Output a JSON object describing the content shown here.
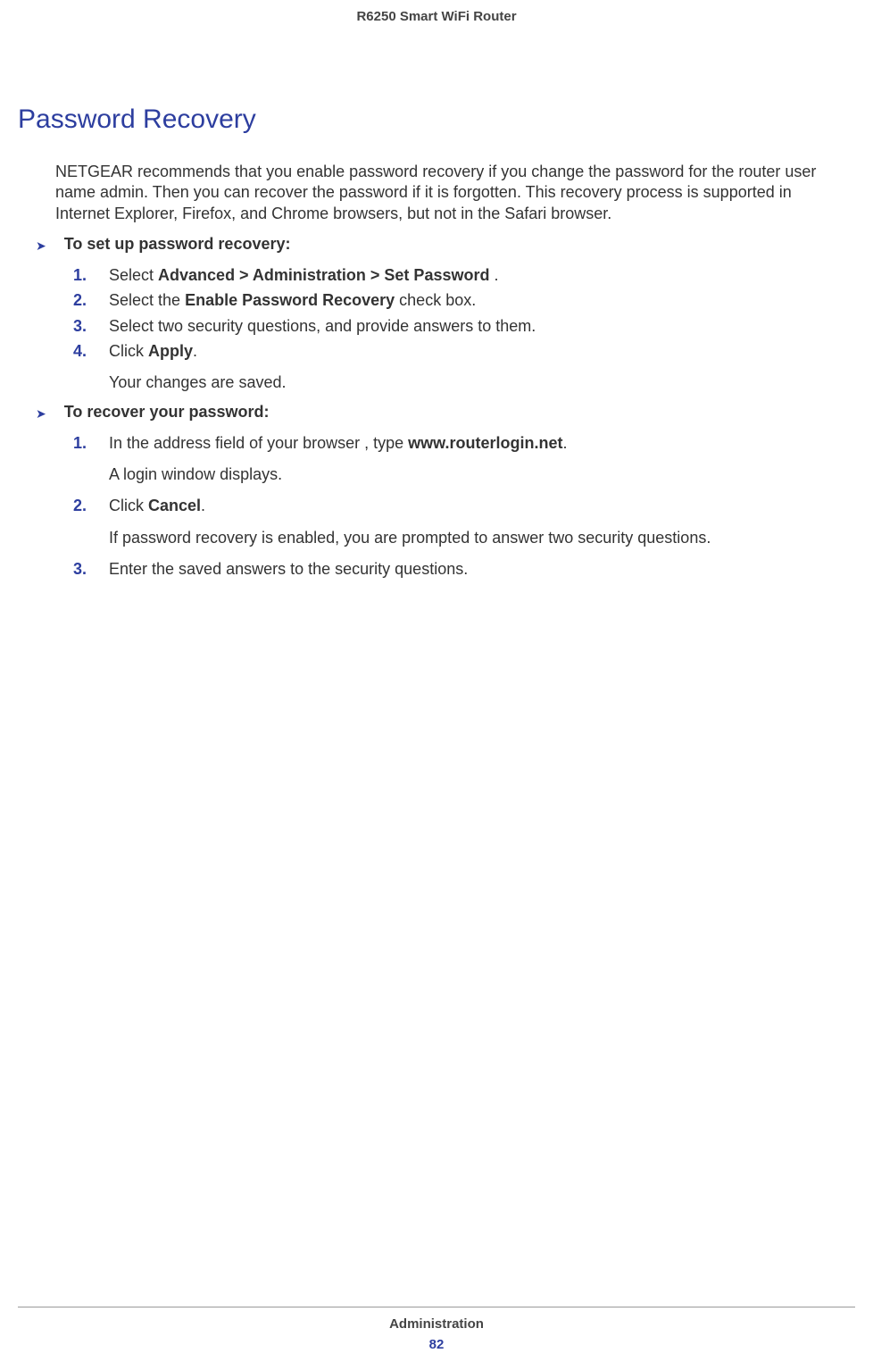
{
  "header": {
    "title": "R6250 Smart WiFi Router"
  },
  "section": {
    "title": "Password Recovery",
    "intro": "NETGEAR recommends that you enable password recovery if you change the password for the router user name admin. Then you can recover the password if it is forgotten. This recovery process is supported in Internet Explorer, Firefox, and Chrome browsers, but not in the Safari browser."
  },
  "procedure1": {
    "title": "To set up password recovery:",
    "steps": {
      "s1_prefix": "Select ",
      "s1_bold": "Advanced > Administration > Set Password",
      "s1_suffix": " .",
      "s2_prefix": "Select the ",
      "s2_bold": "Enable Password Recovery",
      "s2_suffix": " check box.",
      "s3": "Select two security questions, and provide answers to them.",
      "s4_prefix": "Click ",
      "s4_bold": "Apply",
      "s4_suffix": ".",
      "s4_sub": "Your changes are saved."
    }
  },
  "procedure2": {
    "title": "To recover your password:",
    "steps": {
      "s1_prefix": "In the address field of your browser , type ",
      "s1_bold": "www.routerlogin.net",
      "s1_suffix": ".",
      "s1_sub": "A login window displays.",
      "s2_prefix": "Click ",
      "s2_bold": "Cancel",
      "s2_suffix": ".",
      "s2_sub": "If password recovery is enabled, you are prompted to answer two security questions.",
      "s3": "Enter the saved answers to the security questions."
    }
  },
  "numbers": {
    "n1": "1.",
    "n2": "2.",
    "n3": "3.",
    "n4": "4."
  },
  "footer": {
    "section": "Administration",
    "page": "82"
  }
}
